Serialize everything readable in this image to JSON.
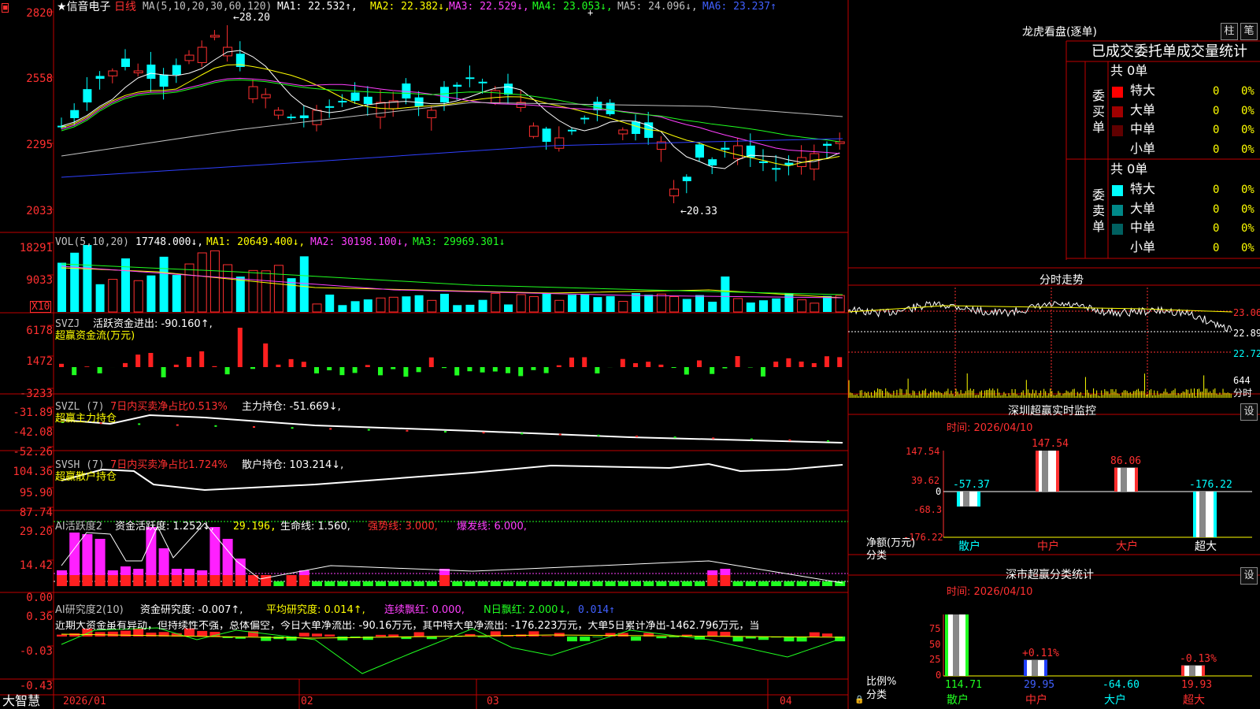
{
  "stock_name": "信音电子",
  "period": "日线",
  "main_chart": {
    "ma_label": "MA(5,10,20,30,60,120)",
    "ma1": "MA1: 22.532↑,",
    "ma2": "MA2: 22.382↓,",
    "ma3": "MA3: 22.529↓,",
    "ma4": "MA4: 23.053↓,",
    "ma5": "MA5: 24.096↓,",
    "ma6": "MA6: 23.237↑",
    "high_marker": "28.20",
    "low_marker": "20.33",
    "y_ticks": [
      "2820",
      "2558",
      "2295",
      "2033"
    ]
  },
  "vol_panel": {
    "label": "VOL(5,10,20)",
    "value": "17748.000↓,",
    "ma1": "MA1: 20649.400↓,",
    "ma2": "MA2: 30198.100↓,",
    "ma3": "MA3: 29969.301↓",
    "y_ticks": [
      "18291",
      "9033"
    ],
    "unit": "X10"
  },
  "svzj_panel": {
    "label": "SVZJ",
    "value": "活跃资金进出: -90.160↑,",
    "subtitle": "超赢资金流(万元)",
    "y_ticks": [
      "6178",
      "1472",
      "-3233"
    ]
  },
  "svzl_panel": {
    "label": "SVZL (7)",
    "ratio": "7日内买卖净占比0.513%",
    "value": "主力持仓: -51.669↓,",
    "subtitle": "超赢主力持仓",
    "y_ticks": [
      "-31.89",
      "-42.08",
      "-52.26"
    ]
  },
  "svsh_panel": {
    "label": "SVSH (7)",
    "ratio": "7日内买卖净占比1.724%",
    "value": "散户持仓: 103.214↓,",
    "subtitle": "超赢散户持仓",
    "y_ticks": [
      "104.36",
      "95.90",
      "87.74"
    ]
  },
  "ai_active_panel": {
    "label": "AI活跃度2",
    "value": "资金活跃度: 1.252↓,",
    "v2": "29.196,",
    "life": "生命线: 1.560,",
    "strong": "强势线: 3.000,",
    "burst": "爆发线: 6.000,",
    "y_ticks": [
      "29.20",
      "14.42",
      "0.00"
    ]
  },
  "ai_research_panel": {
    "label": "AI研究度2(10)",
    "value": "资金研究度: -0.007↑,",
    "avg": "平均研究度: 0.014↑,",
    "red_run": "连续飘红: 0.000,",
    "n_red": "N日飘红: 2.000↓,",
    "last": "0.014↑",
    "comment": "近期大资金虽有异动，但持续性不强，总体偏空，今日大单净流出: -90.16万元，其中特大单净流出: -176.223万元，大单5日累计净出-1462.796万元，当",
    "y_ticks": [
      "0.36",
      "-0.03",
      "-0.43"
    ]
  },
  "x_axis": [
    "2026/01",
    "02",
    "03",
    "04"
  ],
  "brand": "大智慧",
  "right_panel": {
    "longhu_title": "龙虎看盘(逐单)",
    "btn_zhu": "柱",
    "btn_bi": "笔",
    "order_header": "已成交委托单成交量统计",
    "buy_label": "委买单",
    "sell_label": "委卖单",
    "buy_total": "共 0单",
    "sell_total": "共 0单",
    "buy_rows": [
      {
        "name": "特大",
        "count": "0",
        "pct": "0%",
        "color": "#ff0000"
      },
      {
        "name": "大单",
        "count": "0",
        "pct": "0%",
        "color": "#a00000"
      },
      {
        "name": "中单",
        "count": "0",
        "pct": "0%",
        "color": "#600000"
      },
      {
        "name": "小单",
        "count": "0",
        "pct": "0%",
        "color": ""
      }
    ],
    "sell_rows": [
      {
        "name": "特大",
        "count": "0",
        "pct": "0%",
        "color": "#00ffff"
      },
      {
        "name": "大单",
        "count": "0",
        "pct": "0%",
        "color": "#008888"
      },
      {
        "name": "中单",
        "count": "0",
        "pct": "0%",
        "color": "#006060"
      },
      {
        "name": "小单",
        "count": "0",
        "pct": "0%",
        "color": ""
      }
    ],
    "intraday_title": "分时走势",
    "intraday_ticks": [
      "23.06",
      "22.89",
      "22.72",
      "644",
      "分时"
    ],
    "sz_monitor_title": "深圳超赢实时监控",
    "set_label": "设",
    "sz_time": "时间: 2026/04/10",
    "sz_y_ticks": [
      "147.54",
      "39.62",
      "0",
      "-68.3",
      "-176.22"
    ],
    "sz_bars": [
      {
        "cat": "散户",
        "value": -57.37,
        "label": "-57.37"
      },
      {
        "cat": "中户",
        "value": 147.54,
        "label": "147.54"
      },
      {
        "cat": "大户",
        "value": 86.06,
        "label": "86.06"
      },
      {
        "cat": "超大",
        "value": -176.22,
        "label": "-176.22"
      }
    ],
    "sz_ylabel": "净额(万元)",
    "sz_xlabel": "分类",
    "class_title": "深市超赢分类统计",
    "class_time": "时间: 2026/04/10",
    "class_y_ticks": [
      "75",
      "50",
      "25",
      "0"
    ],
    "class_bars": [
      {
        "cat": "散户",
        "pct": 100,
        "top_label": "",
        "bottom": "114.71"
      },
      {
        "cat": "中户",
        "pct": 26,
        "top_label": "+0.11%",
        "bottom": "29.95"
      },
      {
        "cat": "大户",
        "pct": 0,
        "top_label": "",
        "bottom": "-64.60"
      },
      {
        "cat": "超大",
        "pct": 17,
        "top_label": "-0.13%",
        "bottom": "19.93"
      }
    ],
    "class_ylabel": "比例%",
    "class_xlabel": "分类"
  }
}
